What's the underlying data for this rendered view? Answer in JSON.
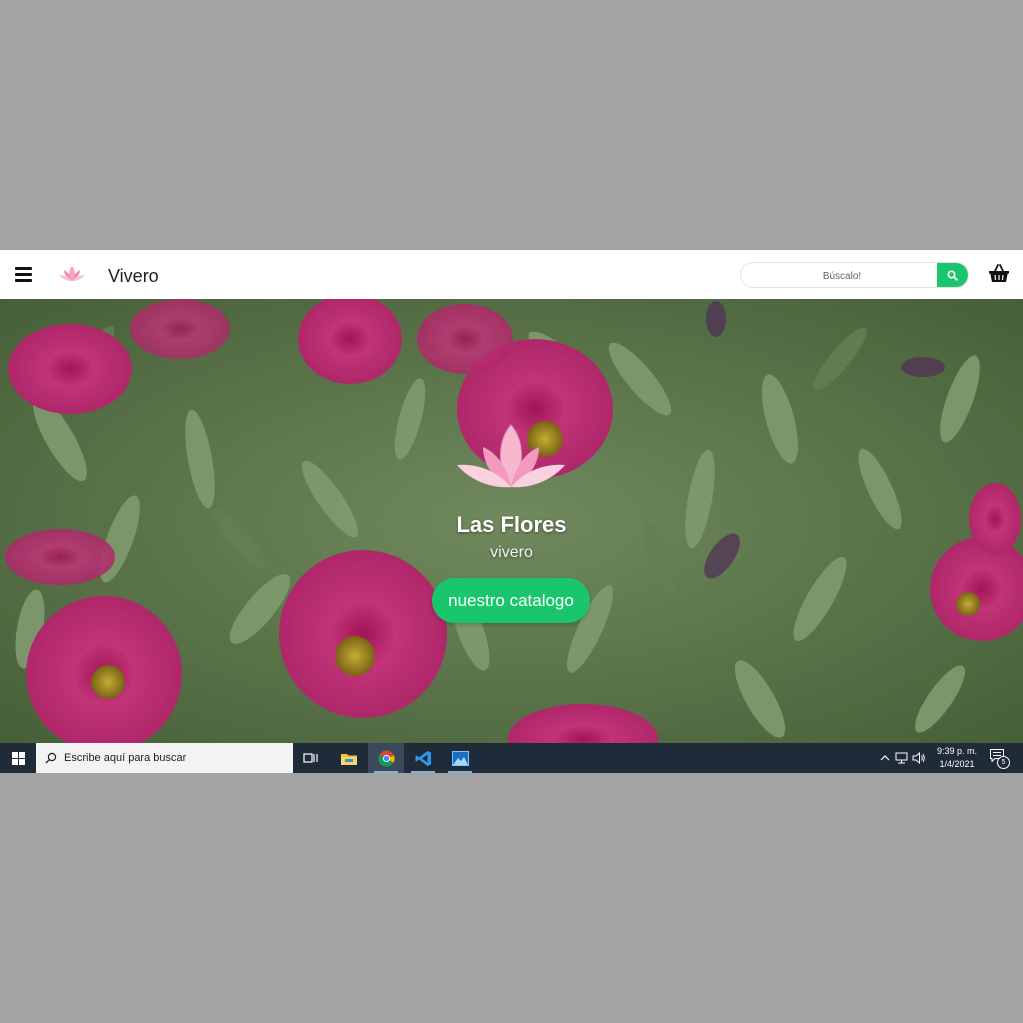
{
  "navbar": {
    "brand": "Vivero",
    "search_placeholder": "Búscalo!",
    "icons": [
      "hamburger-menu-icon",
      "lotus-logo-icon",
      "search-icon",
      "basket-icon"
    ],
    "accent_color": "#19c66c"
  },
  "hero": {
    "title": "Las Flores",
    "subtitle": "vivero",
    "cta_label": "nuestro catalogo"
  },
  "taskbar": {
    "search_text": "Escribe aquí para buscar",
    "apps": [
      "task-view-icon",
      "file-explorer-icon",
      "chrome-icon",
      "vscode-icon",
      "photos-icon"
    ],
    "time": "9:39 p. m.",
    "date": "1/4/2021",
    "notification_count": "5"
  }
}
